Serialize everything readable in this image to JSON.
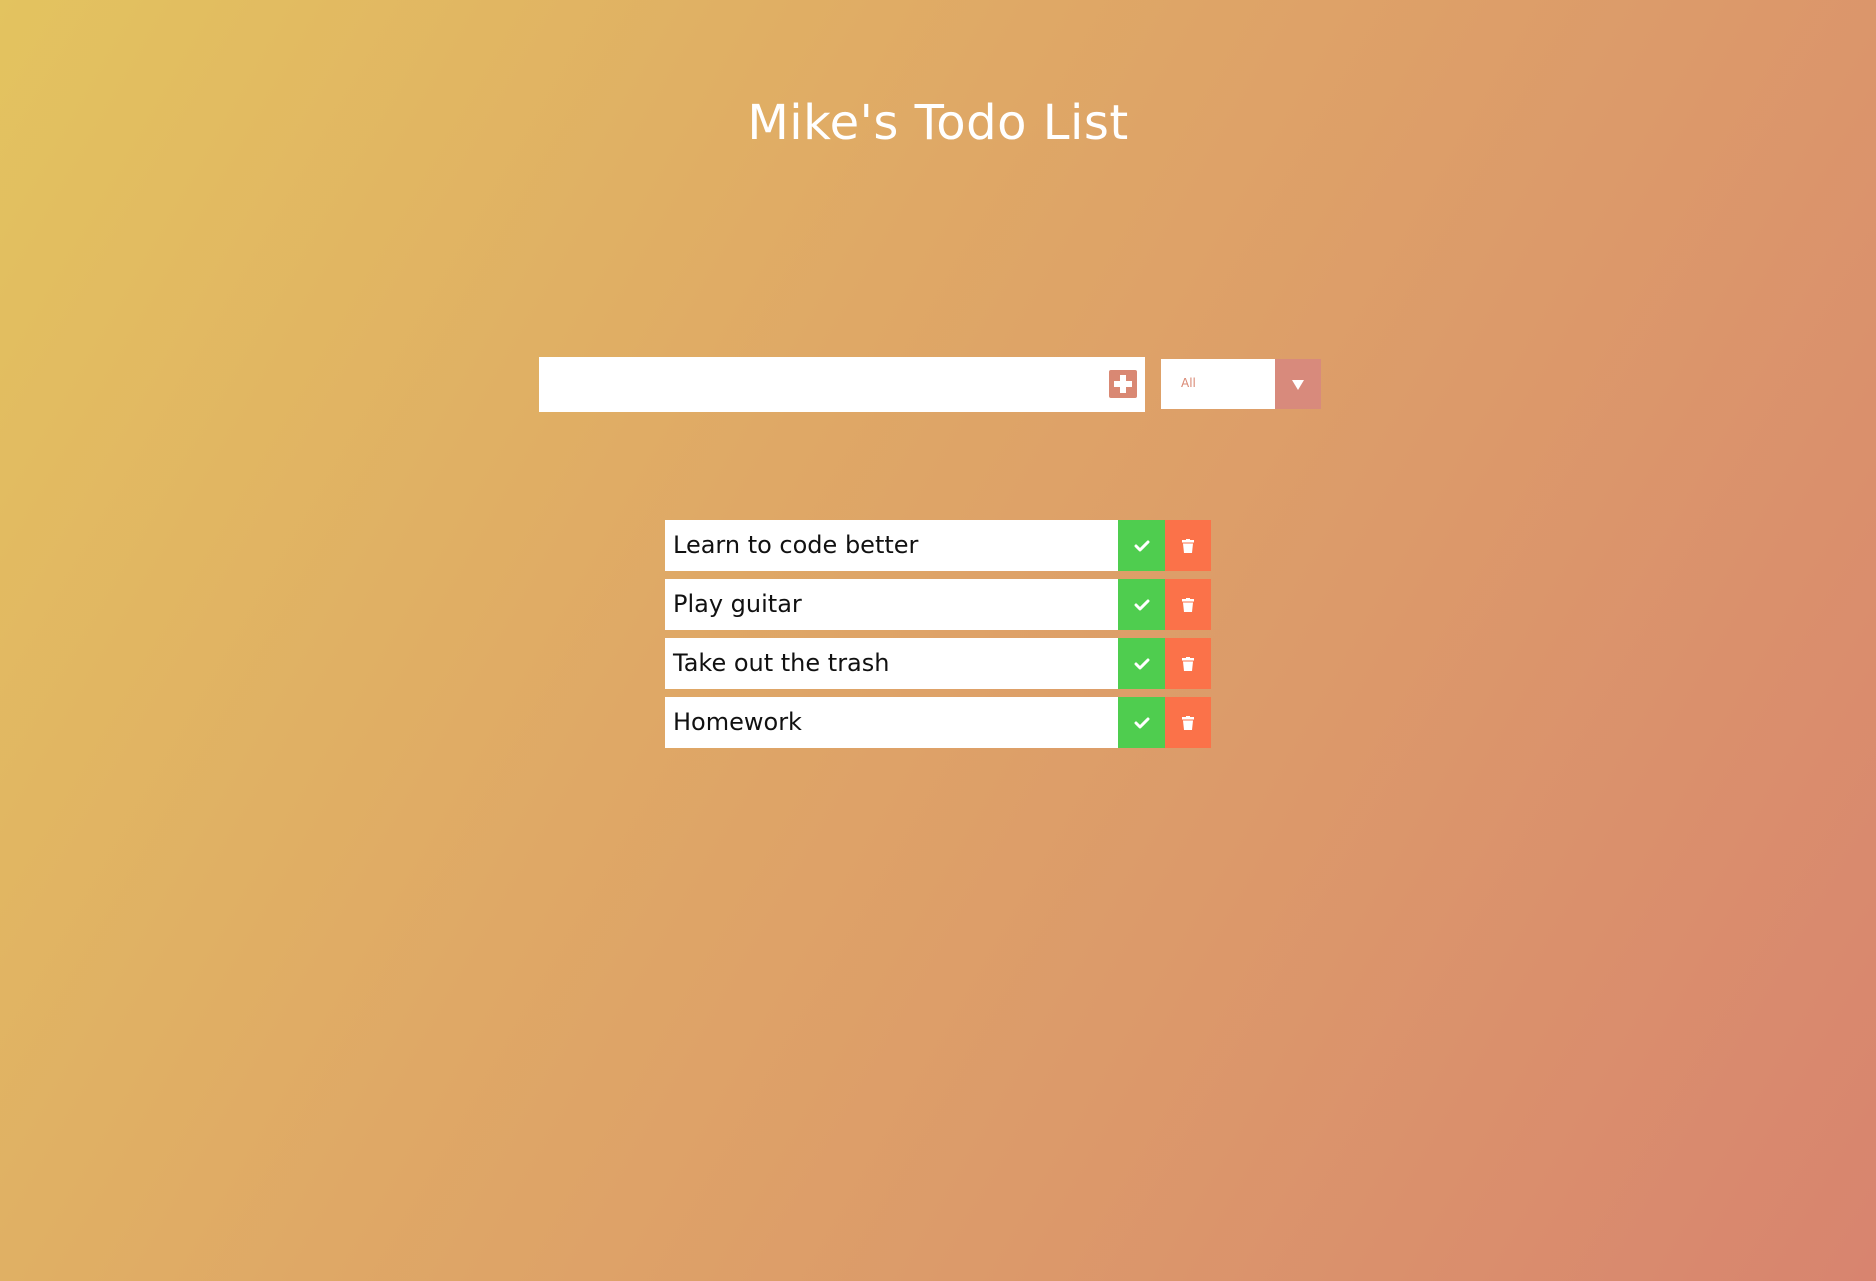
{
  "header": {
    "title": "Mike's Todo List"
  },
  "form": {
    "input_value": "",
    "add_icon": "plus-square-icon",
    "filter_selected": "All",
    "filter_arrow_icon": "caret-down-icon"
  },
  "todos": [
    {
      "text": "Learn to code better",
      "complete_icon": "check-icon",
      "delete_icon": "trash-icon"
    },
    {
      "text": "Play guitar",
      "complete_icon": "check-icon",
      "delete_icon": "trash-icon"
    },
    {
      "text": "Take out the trash",
      "complete_icon": "check-icon",
      "delete_icon": "trash-icon"
    },
    {
      "text": "Homework",
      "complete_icon": "check-icon",
      "delete_icon": "trash-icon"
    }
  ],
  "colors": {
    "accent": "#d98873",
    "complete": "#4fcd4f",
    "delete": "#fb7249",
    "title": "#ffffff"
  }
}
